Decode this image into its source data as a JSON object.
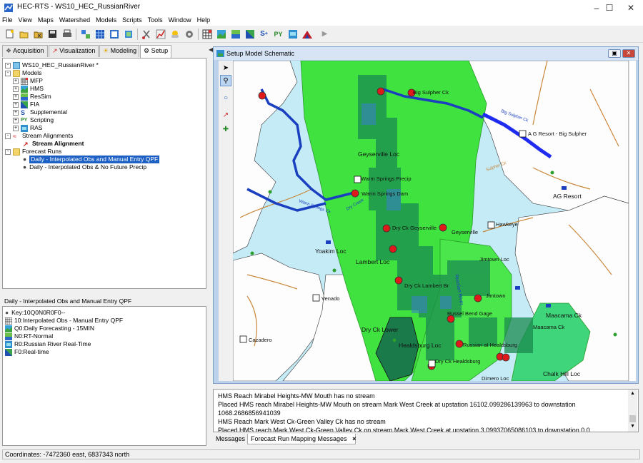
{
  "window": {
    "title": "HEC-RTS - WS10_HEC_RussianRiver"
  },
  "menu": [
    "File",
    "View",
    "Maps",
    "Watershed",
    "Models",
    "Scripts",
    "Tools",
    "Window",
    "Help"
  ],
  "toolbar_icons": [
    "new-icon",
    "open-icon",
    "close-icon",
    "save-icon",
    "print-icon",
    "network-icon",
    "grid-icon",
    "compute-icon",
    "layers-icon",
    "cut-icon",
    "chart-icon",
    "weather-icon",
    "settings-icon",
    "mfp-icon",
    "hms-icon",
    "ressim-icon",
    "fia-icon",
    "supplemental-icon",
    "scripting-icon",
    "ras-icon",
    "stats-icon",
    "run-icon"
  ],
  "left_tabs": [
    {
      "label": "Acquisition"
    },
    {
      "label": "Visualization"
    },
    {
      "label": "Modeling"
    },
    {
      "label": "Setup"
    }
  ],
  "tree": {
    "root": "WS10_HEC_RussianRiver *",
    "models_label": "Models",
    "models": [
      "MFP",
      "HMS",
      "ResSim",
      "FIA",
      "Supplemental",
      "Scripting",
      "RAS"
    ],
    "alignments_label": "Stream Alignments",
    "alignment_item": "Stream Alignment",
    "forecast_label": "Forecast Runs",
    "forecast_items": [
      "Daily - Interpolated Obs and Manual Entry QPF",
      "Daily - Interpolated Obs & No Future Precip"
    ]
  },
  "selected_run": "Daily - Interpolated Obs and Manual Entry QPF",
  "key_items": [
    "Key:10Q0N0R0F0--",
    "10:Interpolated Obs - Manual Entry QPF",
    "Q0:Daily Forecasting - 15MIN",
    "N0:RT-Normal",
    "R0:Russian River Real-Time",
    "F0:Real-time"
  ],
  "schematic": {
    "title": "Setup Model Schematic",
    "labels": {
      "big_sulpher": "Big Sulpher Ck",
      "ag_resort_bs": "A G Resort - Big Sulpher",
      "ag_resort": "AG Resort",
      "geyserville_loc": "Geyserville Loc",
      "warm_springs_precip": "Warm Springs Precip",
      "warm_springs_dam": "Warm Springs Dam",
      "dry_ck_geyserville": "Dry Ck Geyserville",
      "geyserville": "Geyserville",
      "hawkeye": "Hawkeye",
      "yoakim_loc": "Yoakim Loc",
      "lambert_loc": "Lambert Loc",
      "jimtown_loc": "Jimtown Loc",
      "dry_ck_lambert_br": "Dry Ck Lambert Br",
      "jimtown": "Jimtown",
      "venado": "Venado",
      "maacama_ck": "Maacama Ck",
      "russel_bend": "Russel Bend Gage",
      "dry_ck_lower": "Dry Ck Lower",
      "maacama": "Maacama Ck",
      "cazadero": "Cazadero",
      "healdsburg_loc": "Healdsburg Loc",
      "russian_healdsburg": "Russian at Healdsburg",
      "dry_ck_healdsburg": "Dry Ck Healdsburg",
      "chalk_hill_loc": "Chalk Hill Loc",
      "dimero_loc": "Dimero Loc",
      "russian_river": "Russian River",
      "big_sulpher_river": "Big Sulpher Ck",
      "warm_springs_river": "Warm Springs Ck",
      "dry_creek": "Dry Creek",
      "sulpher_ck": "Sulpher Ck"
    }
  },
  "messages": [
    "HMS Reach Mirabel Heights-MW Mouth has no stream",
    "Placed HMS reach Mirabel Heights-MW Mouth on stream Mark West Creek at upstation 16102.099286139963 to downstation",
    "1068.2686856941039",
    "HMS Reach Mark West Ck-Green Valley Ck has no stream",
    "Placed HMS reach Mark West Ck-Green Valley Ck on stream Mark West Creek at upstation 3.09937065086103 to downstation 0.0"
  ],
  "message_tabs": [
    "Messages",
    "Forecast Run Mapping Messages"
  ],
  "status": "Coordinates: -7472360 east, 6837343 north"
}
